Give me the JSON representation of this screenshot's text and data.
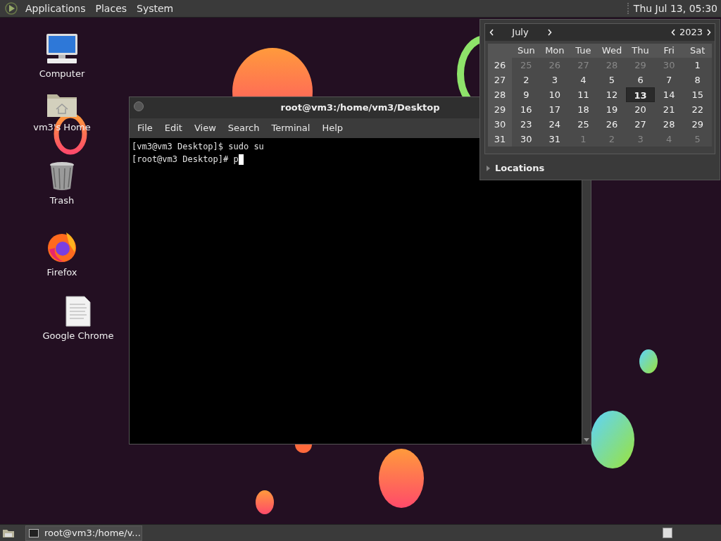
{
  "top_panel": {
    "menus": [
      "Applications",
      "Places",
      "System"
    ],
    "clock": "Thu Jul 13, 05:30"
  },
  "desktop_icons": [
    {
      "kind": "computer",
      "label": "Computer"
    },
    {
      "kind": "home",
      "label": "vm3's Home"
    },
    {
      "kind": "trash",
      "label": "Trash"
    },
    {
      "kind": "firefox",
      "label": "Firefox"
    },
    {
      "kind": "document",
      "label": "Google Chrome"
    }
  ],
  "terminal": {
    "title": "root@vm3:/home/vm3/Desktop",
    "menus": [
      "File",
      "Edit",
      "View",
      "Search",
      "Terminal",
      "Help"
    ],
    "lines": [
      "[vm3@vm3 Desktop]$ sudo su",
      "[root@vm3 Desktop]# p"
    ]
  },
  "calendar": {
    "month": "July",
    "year": "2023",
    "weekdays": [
      "Sun",
      "Mon",
      "Tue",
      "Wed",
      "Thu",
      "Fri",
      "Sat"
    ],
    "weeks": [
      {
        "number": "26",
        "days": [
          {
            "text": "25",
            "in_month": false,
            "selected": false
          },
          {
            "text": "26",
            "in_month": false,
            "selected": false
          },
          {
            "text": "27",
            "in_month": false,
            "selected": false
          },
          {
            "text": "28",
            "in_month": false,
            "selected": false
          },
          {
            "text": "29",
            "in_month": false,
            "selected": false
          },
          {
            "text": "30",
            "in_month": false,
            "selected": false
          },
          {
            "text": "1",
            "in_month": true,
            "selected": false
          }
        ]
      },
      {
        "number": "27",
        "days": [
          {
            "text": "2",
            "in_month": true,
            "selected": false
          },
          {
            "text": "3",
            "in_month": true,
            "selected": false
          },
          {
            "text": "4",
            "in_month": true,
            "selected": false
          },
          {
            "text": "5",
            "in_month": true,
            "selected": false
          },
          {
            "text": "6",
            "in_month": true,
            "selected": false
          },
          {
            "text": "7",
            "in_month": true,
            "selected": false
          },
          {
            "text": "8",
            "in_month": true,
            "selected": false
          }
        ]
      },
      {
        "number": "28",
        "days": [
          {
            "text": "9",
            "in_month": true,
            "selected": false
          },
          {
            "text": "10",
            "in_month": true,
            "selected": false
          },
          {
            "text": "11",
            "in_month": true,
            "selected": false
          },
          {
            "text": "12",
            "in_month": true,
            "selected": false
          },
          {
            "text": "13",
            "in_month": true,
            "selected": true
          },
          {
            "text": "14",
            "in_month": true,
            "selected": false
          },
          {
            "text": "15",
            "in_month": true,
            "selected": false
          }
        ]
      },
      {
        "number": "29",
        "days": [
          {
            "text": "16",
            "in_month": true,
            "selected": false
          },
          {
            "text": "17",
            "in_month": true,
            "selected": false
          },
          {
            "text": "18",
            "in_month": true,
            "selected": false
          },
          {
            "text": "19",
            "in_month": true,
            "selected": false
          },
          {
            "text": "20",
            "in_month": true,
            "selected": false
          },
          {
            "text": "21",
            "in_month": true,
            "selected": false
          },
          {
            "text": "22",
            "in_month": true,
            "selected": false
          }
        ]
      },
      {
        "number": "30",
        "days": [
          {
            "text": "23",
            "in_month": true,
            "selected": false
          },
          {
            "text": "24",
            "in_month": true,
            "selected": false
          },
          {
            "text": "25",
            "in_month": true,
            "selected": false
          },
          {
            "text": "26",
            "in_month": true,
            "selected": false
          },
          {
            "text": "27",
            "in_month": true,
            "selected": false
          },
          {
            "text": "28",
            "in_month": true,
            "selected": false
          },
          {
            "text": "29",
            "in_month": true,
            "selected": false
          }
        ]
      },
      {
        "number": "31",
        "days": [
          {
            "text": "30",
            "in_month": true,
            "selected": false
          },
          {
            "text": "31",
            "in_month": true,
            "selected": false
          },
          {
            "text": "1",
            "in_month": false,
            "selected": false
          },
          {
            "text": "2",
            "in_month": false,
            "selected": false
          },
          {
            "text": "3",
            "in_month": false,
            "selected": false
          },
          {
            "text": "4",
            "in_month": false,
            "selected": false
          },
          {
            "text": "5",
            "in_month": false,
            "selected": false
          }
        ]
      }
    ],
    "locations": {
      "label": "Locations",
      "expanded": false
    }
  },
  "bottom_panel": {
    "tasks": [
      {
        "title": "root@vm3:/home/v..."
      }
    ]
  }
}
